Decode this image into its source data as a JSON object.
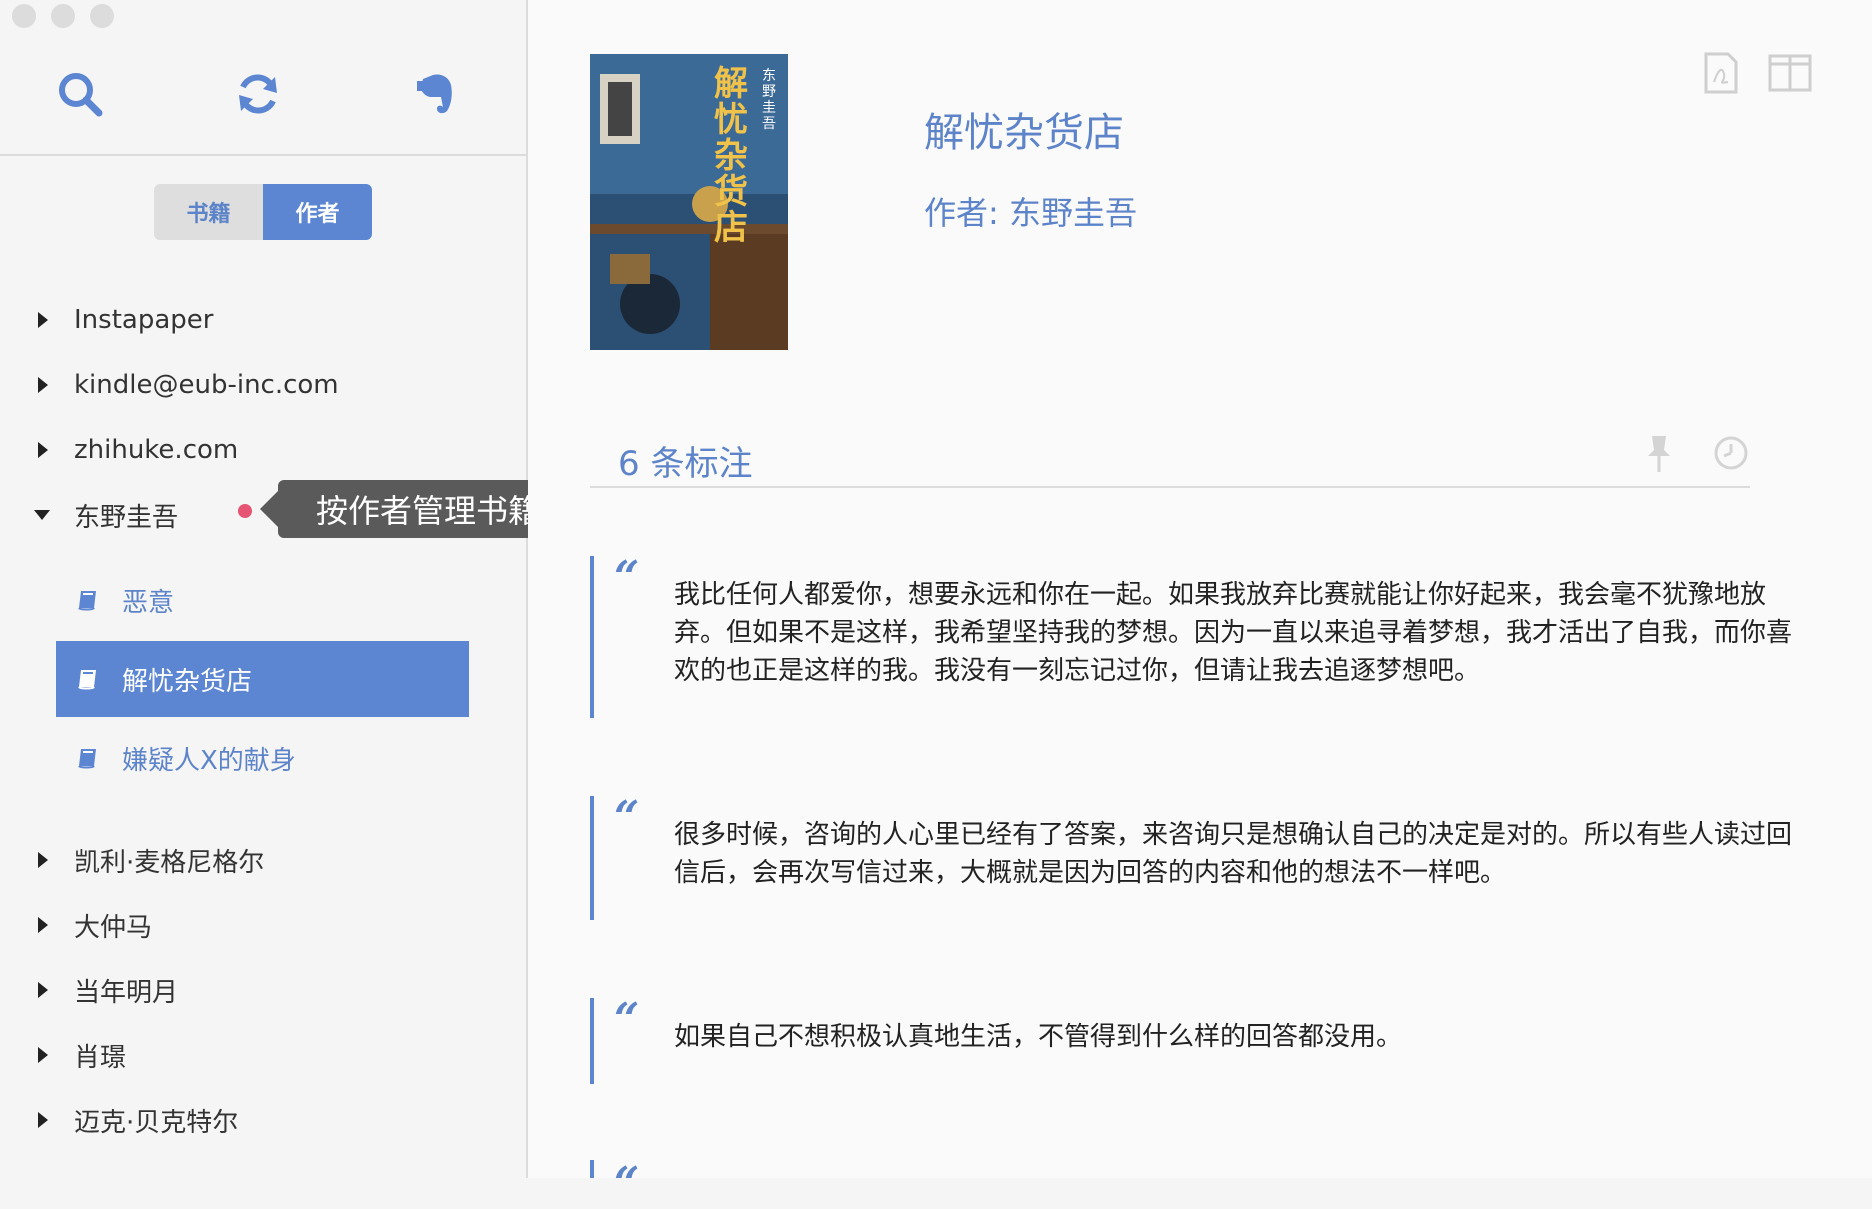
{
  "sidebar": {
    "segments": {
      "books": "书籍",
      "authors": "作者"
    },
    "groups": [
      {
        "label": "Instapaper",
        "expanded": false
      },
      {
        "label": "kindle@eub-inc.com",
        "expanded": false
      },
      {
        "label": "zhihuke.com",
        "expanded": false
      },
      {
        "label": "东野圭吾",
        "expanded": true
      },
      {
        "label": "凯利·麦格尼格尔",
        "expanded": false
      },
      {
        "label": "大仲马",
        "expanded": false
      },
      {
        "label": "当年明月",
        "expanded": false
      },
      {
        "label": "肖璟",
        "expanded": false
      },
      {
        "label": "迈克·贝克特尔",
        "expanded": false
      }
    ],
    "books": [
      {
        "label": "恶意",
        "selected": false
      },
      {
        "label": "解忧杂货店",
        "selected": true
      },
      {
        "label": "嫌疑人X的献身",
        "selected": false
      }
    ],
    "tooltip": "按作者管理书籍"
  },
  "detail": {
    "title": "解忧杂货店",
    "author": "作者: 东野圭吾",
    "cover": {
      "title": "解忧杂货店",
      "author": "东野圭吾"
    },
    "highlight_count": "6 条标注",
    "highlights": [
      "我比任何人都爱你，想要永远和你在一起。如果我放弃比赛就能让你好起来，我会毫不犹豫地放弃。但如果不是这样，我希望坚持我的梦想。因为一直以来追寻着梦想，我才活出了自我，而你喜欢的也正是这样的我。我没有一刻忘记过你，但请让我去追逐梦想吧。",
      "很多时候，咨询的人心里已经有了答案，来咨询只是想确认自己的决定是对的。所以有些人读过回信后，会再次写信过来，大概就是因为回答的内容和他的想法不一样吧。",
      "如果自己不想积极认真地生活，不管得到什么样的回答都没用。"
    ],
    "quote_mark": "“"
  },
  "colors": {
    "accent": "#5c86d2",
    "tooltip_bg": "#5a5a5a",
    "dot": "#e55473"
  }
}
